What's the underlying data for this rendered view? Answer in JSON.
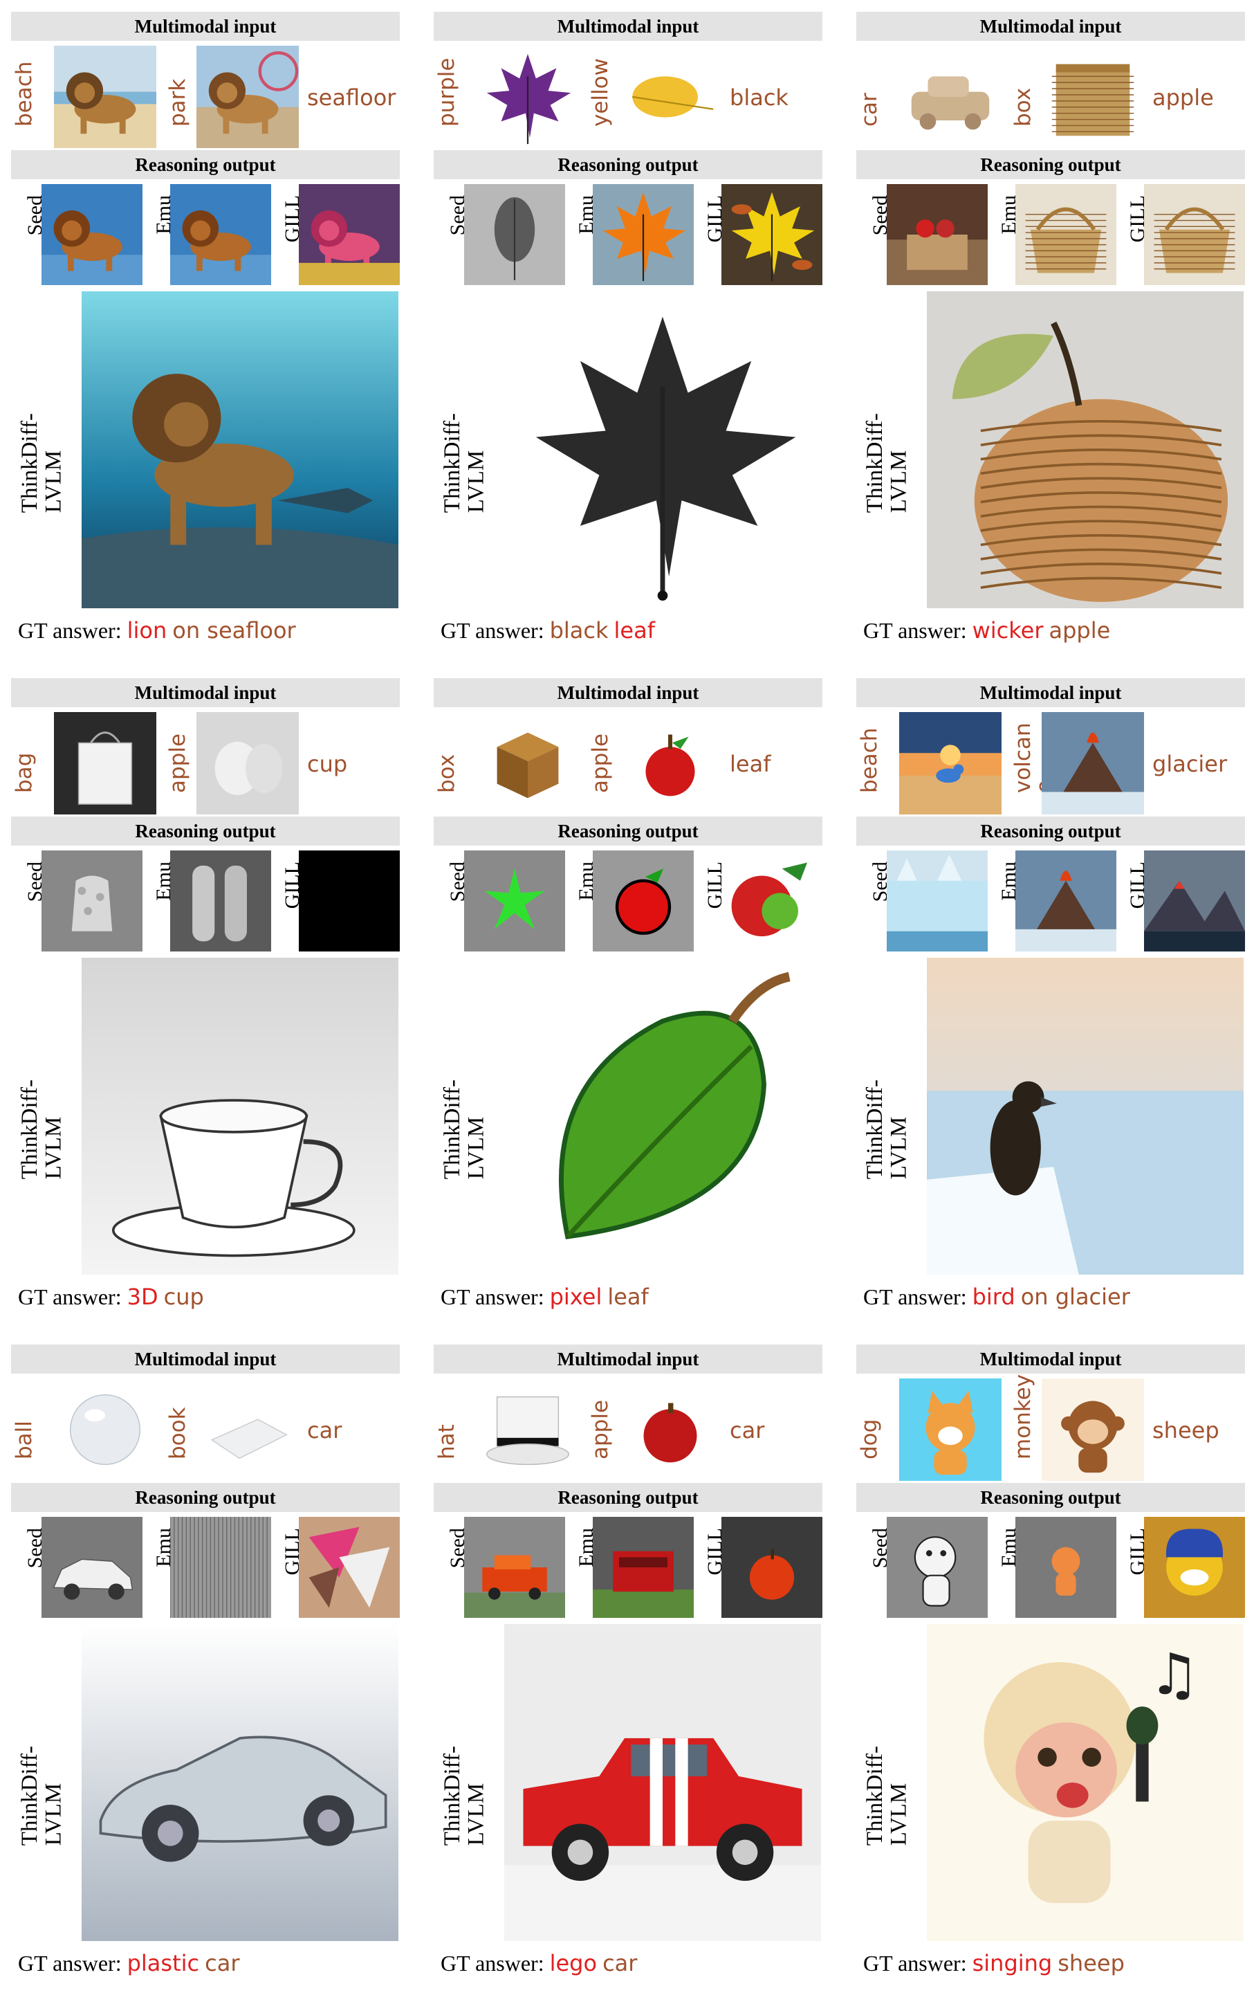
{
  "labels": {
    "input_header": "Multimodal input",
    "output_header": "Reasoning output",
    "seed": "Seed",
    "emu": "Emu",
    "gill": "GILL",
    "model_line1": "ThinkDiff-",
    "model_line2": "LVLM",
    "gt_prefix": "GT answer:"
  },
  "panels": [
    {
      "w1": "beach",
      "w2": "park",
      "w3": "seafloor",
      "gt_red": "lion",
      "gt_brown": "on seafloor",
      "images": {
        "in1": "lion on beach",
        "in2": "lion in park",
        "seed": "lion",
        "emu": "lion",
        "gill": "pink lion",
        "main": "lion on seafloor"
      }
    },
    {
      "w1": "purple",
      "w2": "yellow",
      "w3": "black",
      "gt_red": "leaf",
      "gt_brown": "black",
      "images": {
        "in1": "purple maple leaf",
        "in2": "yellow leaf",
        "seed": "grey leaf",
        "emu": "orange maple leaf",
        "gill": "yellow leaves",
        "main": "black leaf"
      }
    },
    {
      "w1": "car",
      "w2": "box",
      "w3": "apple",
      "gt_red": "wicker",
      "gt_brown": "apple",
      "images": {
        "in1": "wicker car",
        "in2": "wicker box",
        "seed": "apple box",
        "emu": "wicker basket",
        "gill": "wicker basket",
        "main": "wicker apple"
      }
    },
    {
      "w1": "bag",
      "w2": "apple",
      "w3": "cup",
      "gt_red": "3D",
      "gt_brown": "cup",
      "images": {
        "in1": "3D bag",
        "in2": "3D apple",
        "seed": "3D object",
        "emu": "3D vases",
        "gill": "black",
        "main": "3D cup"
      }
    },
    {
      "w1": "box",
      "w2": "apple",
      "w3": "leaf",
      "gt_red": "pixel",
      "gt_brown": "leaf",
      "images": {
        "in1": "pixel box",
        "in2": "pixel apple",
        "seed": "green star",
        "emu": "red apple",
        "gill": "pixel apples",
        "main": "pixel leaf"
      }
    },
    {
      "w1": "beach",
      "w2": "volcan\no",
      "w3": "glacier",
      "gt_red": "bird",
      "gt_brown": "on glacier",
      "images": {
        "in1": "bird on beach",
        "in2": "volcano",
        "seed": "glacier",
        "emu": "volcano",
        "gill": "mountains",
        "main": "bird on glacier"
      }
    },
    {
      "w1": "ball",
      "w2": "book",
      "w3": "car",
      "gt_red": "plastic",
      "gt_brown": "car",
      "images": {
        "in1": "plastic ball",
        "in2": "plastic book",
        "seed": "white car",
        "emu": "grey texture",
        "gill": "pink shapes",
        "main": "plastic car"
      }
    },
    {
      "w1": "hat",
      "w2": "apple",
      "w3": "car",
      "gt_red": "lego",
      "gt_brown": "car",
      "images": {
        "in1": "lego hat",
        "in2": "lego apple",
        "seed": "lego car",
        "emu": "lego bus",
        "gill": "apple",
        "main": "lego car"
      }
    },
    {
      "w1": "dog",
      "w2": "monkey",
      "w3": "sheep",
      "gt_red": "singing",
      "gt_brown": "sheep",
      "images": {
        "in1": "singing dog",
        "in2": "singing monkey",
        "seed": "cartoon goat",
        "emu": "cartoon fox",
        "gill": "cartoon dog",
        "main": "singing sheep"
      }
    }
  ],
  "colors": {
    "word": "#a0522d",
    "answer_red": "#e02020",
    "header_bg": "#e3e3e3"
  }
}
